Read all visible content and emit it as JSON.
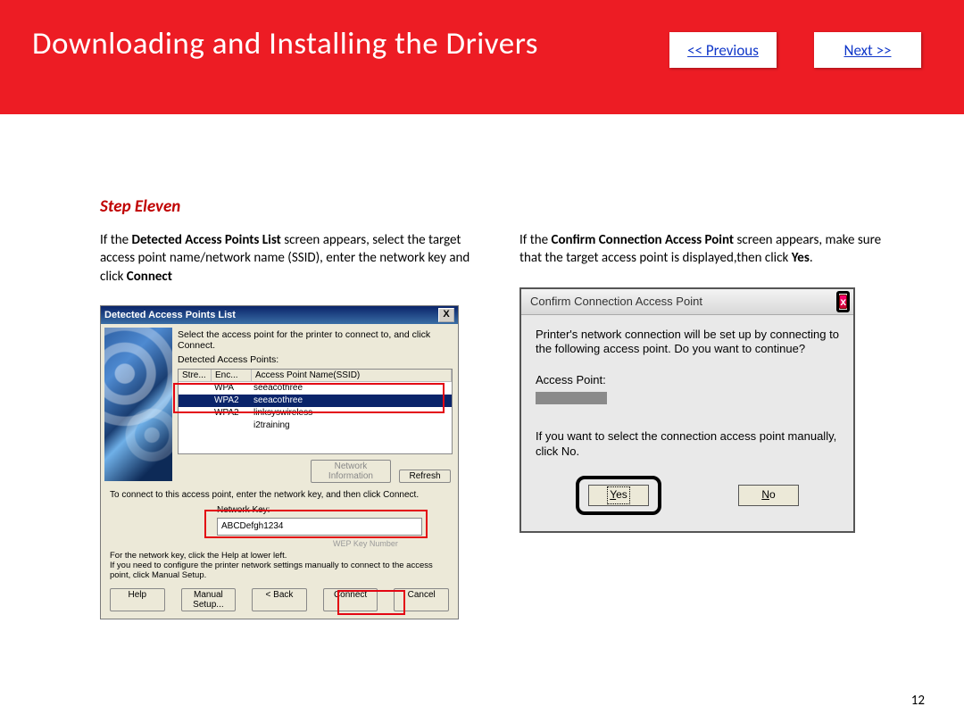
{
  "header": {
    "title": "Downloading and Installing  the Drivers",
    "prev": "<< Previous",
    "next": "Next >>"
  },
  "step": {
    "title": "Step Eleven",
    "left_instr_a": "If the ",
    "left_instr_b": "Detected Access Points List",
    "left_instr_c": " screen appears, select the target access point name/network name (SSID), enter the network key and click ",
    "left_instr_d": "Connect",
    "right_instr_a": "If the ",
    "right_instr_b": "Confirm Connection Access Point",
    "right_instr_c": " screen appears, make sure that the target access point is displayed,then click ",
    "right_instr_d": "Yes",
    "right_instr_e": "."
  },
  "dlg1": {
    "title": "Detected Access Points List",
    "msg": "Select the access point for the printer to connect to, and click Connect.",
    "listlabel": "Detected Access Points:",
    "cols": {
      "str": "Stre...",
      "enc": "Enc...",
      "ap": "Access Point Name(SSID)"
    },
    "rows": [
      {
        "enc": "WPA",
        "ap": "seeacothree"
      },
      {
        "enc": "WPA2",
        "ap": "seeacothree"
      },
      {
        "enc": "WPA2",
        "ap": "linksyswireless"
      },
      {
        "enc": "",
        "ap": "i2training"
      }
    ],
    "btn_netinfo": "Network Information",
    "btn_refresh": "Refresh",
    "connect_msg": "To connect to this access point, enter the network key, and then click Connect.",
    "nkey_label": "Network Key:",
    "nkey_value": "ABCDefgh1234",
    "wep": "WEP Key Number",
    "help_note": "For the network key, click the Help at lower left.\nIf you need to configure the printer network settings manually to connect to the access point, click Manual Setup.",
    "b_help": "Help",
    "b_manual": "Manual Setup...",
    "b_back": "< Back",
    "b_connect": "Connect",
    "b_cancel": "Cancel"
  },
  "dlg2": {
    "title": "Confirm Connection Access Point",
    "line1": "Printer's network connection will be set up by connecting to the following access point. Do you want to continue?",
    "ap_label": "Access Point:",
    "line2": "If you want to select the connection access point manually, click No.",
    "yes": "Yes",
    "no": "No",
    "y": "Y",
    "es": "es",
    "n": "N",
    "o": "o"
  },
  "page_num": "12"
}
